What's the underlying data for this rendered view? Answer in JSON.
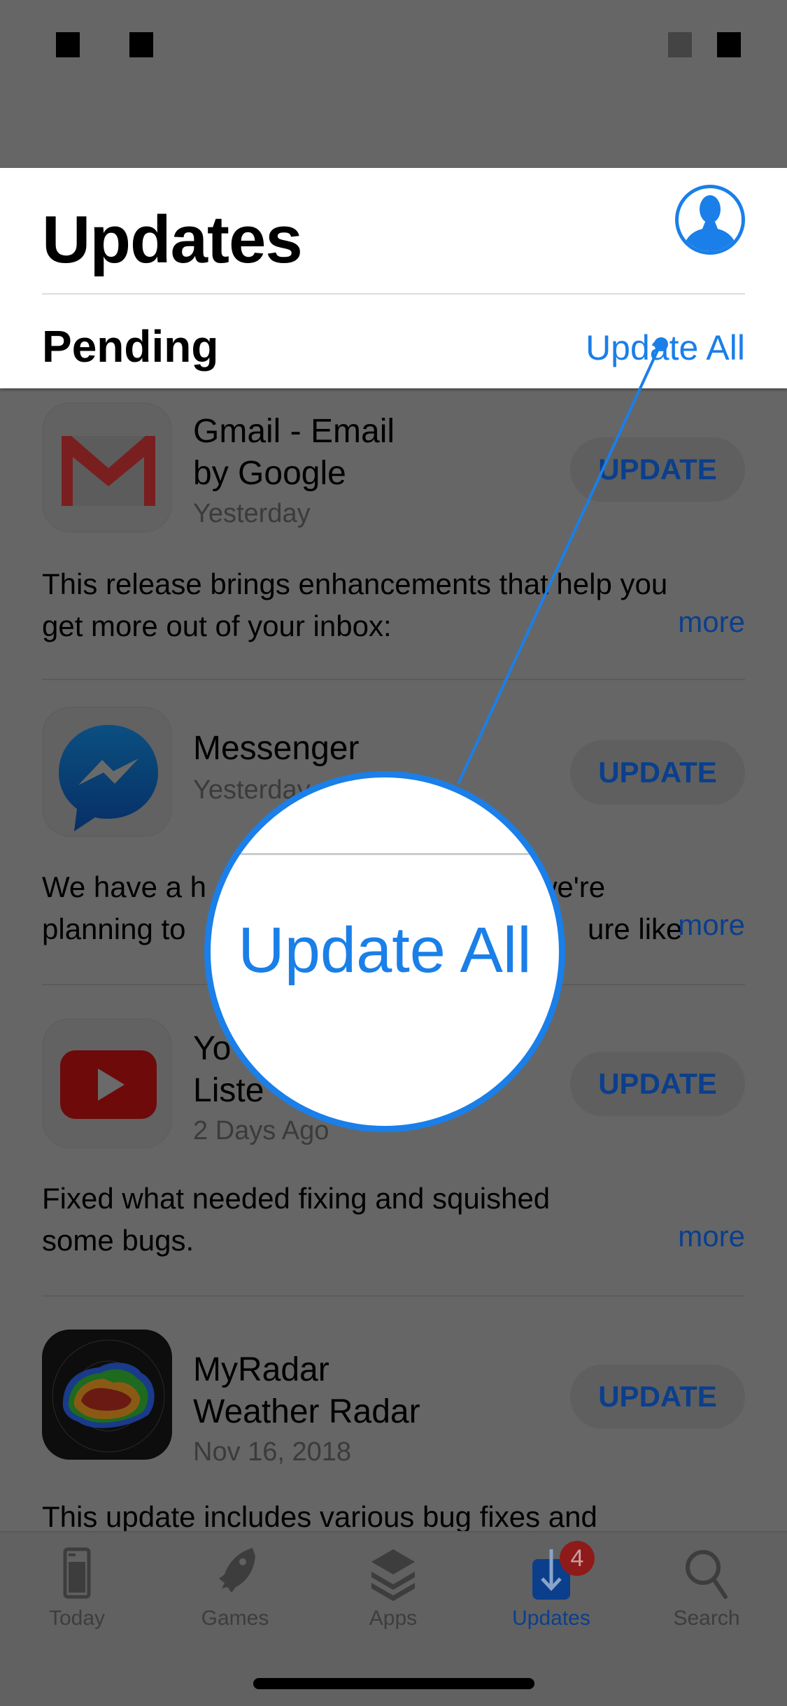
{
  "header": {
    "title": "Updates",
    "section_title": "Pending",
    "update_all_label": "Update All",
    "account_icon": "person-circle-icon"
  },
  "apps": [
    {
      "name_line1": "Gmail - Email",
      "name_line2": "by Google",
      "date": "Yesterday",
      "button": "UPDATE",
      "notes_line1": "This release brings enhancements that help you",
      "notes_line2": "get more out of your inbox:",
      "more": "more",
      "icon": "gmail-icon"
    },
    {
      "name_line1": "Messenger",
      "name_line2": "",
      "date": "Yesterday",
      "button": "UPDATE",
      "notes_line1": "We have a h",
      "notes_line1_tail": "we're",
      "notes_line2": "planning to",
      "notes_line2_tail": "ure like",
      "more": "more",
      "icon": "messenger-icon"
    },
    {
      "name_line1": "Yo",
      "name_line2": "Liste",
      "date": "2 Days Ago",
      "button": "UPDATE",
      "notes_line1": "Fixed what needed fixing and squished",
      "notes_line2": "some bugs.",
      "more": "more",
      "icon": "youtube-icon"
    },
    {
      "name_line1": "MyRadar",
      "name_line2": "Weather Radar",
      "date": "Nov 16, 2018",
      "button": "UPDATE",
      "notes_line1": "This update includes various bug fixes and",
      "icon": "myradar-icon"
    }
  ],
  "magnifier": {
    "text": "Update All"
  },
  "tabbar": {
    "tabs": [
      {
        "label": "Today",
        "icon": "today-icon"
      },
      {
        "label": "Games",
        "icon": "rocket-icon"
      },
      {
        "label": "Apps",
        "icon": "layers-icon"
      },
      {
        "label": "Updates",
        "icon": "download-icon",
        "badge": "4",
        "active": true
      },
      {
        "label": "Search",
        "icon": "search-icon"
      }
    ]
  },
  "colors": {
    "accent": "#1a7fe8",
    "dimmed_accent": "#0b3f8c",
    "badge": "#8f1a1a",
    "overlay": "#666666"
  }
}
